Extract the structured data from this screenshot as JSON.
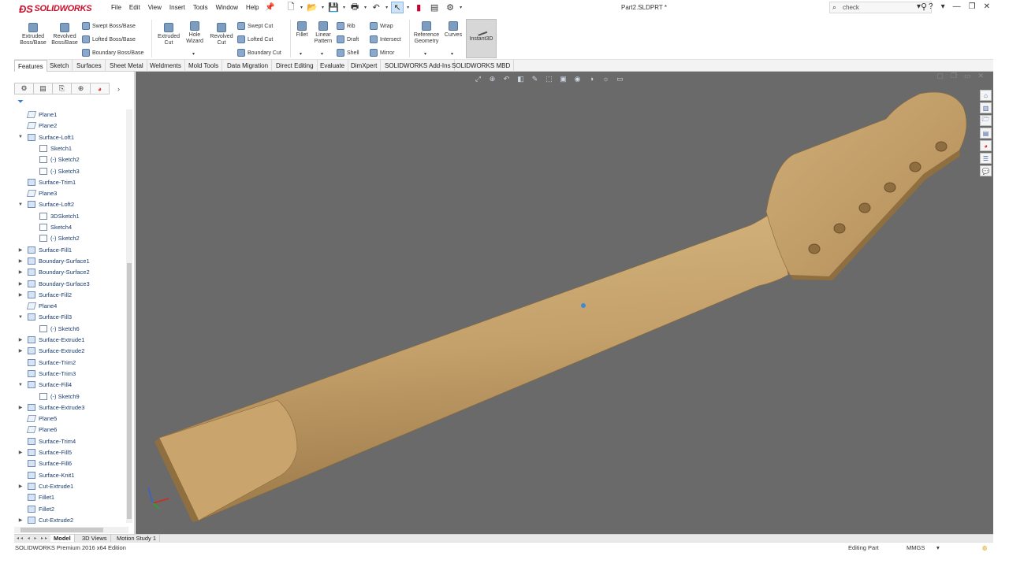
{
  "titlebar": {
    "app": "SOLIDWORKS",
    "menus": [
      "File",
      "Edit",
      "View",
      "Insert",
      "Tools",
      "Window",
      "Help"
    ],
    "document": "Part2.SLDPRT *",
    "search_value": "check",
    "help": "?"
  },
  "ribbon": {
    "extruded_boss": "Extruded Boss/Base",
    "revolved_boss": "Revolved Boss/Base",
    "swept_boss": "Swept Boss/Base",
    "lofted_boss": "Lofted Boss/Base",
    "boundary_boss": "Boundary Boss/Base",
    "extruded_cut": "Extruded Cut",
    "hole_wizard": "Hole Wizard",
    "revolved_cut": "Revolved Cut",
    "swept_cut": "Swept Cut",
    "lofted_cut": "Lofted Cut",
    "boundary_cut": "Boundary Cut",
    "fillet": "Fillet",
    "linear_pattern": "Linear Pattern",
    "rib": "Rib",
    "draft": "Draft",
    "shell": "Shell",
    "wrap": "Wrap",
    "intersect": "Intersect",
    "mirror": "Mirror",
    "reference_geometry": "Reference Geometry",
    "curves": "Curves",
    "instant3d": "Instant3D"
  },
  "tabs": [
    "Features",
    "Sketch",
    "Surfaces",
    "Sheet Metal",
    "Weldments",
    "Mold Tools",
    "Data Migration",
    "Direct Editing",
    "Evaluate",
    "DimXpert",
    "SOLIDWORKS Add-Ins",
    "SOLIDWORKS MBD"
  ],
  "tree": [
    {
      "label": "Plane1",
      "level": 0,
      "icon": "plane-icon",
      "expand": ""
    },
    {
      "label": "Plane2",
      "level": 0,
      "icon": "plane-icon",
      "expand": ""
    },
    {
      "label": "Surface-Loft1",
      "level": 0,
      "icon": "surface-loft-icon",
      "expand": "▼"
    },
    {
      "label": "Sketch1",
      "level": 1,
      "icon": "sketch-icon",
      "expand": ""
    },
    {
      "label": "(-) Sketch2",
      "level": 1,
      "icon": "sketch-icon",
      "expand": ""
    },
    {
      "label": "(-) Sketch3",
      "level": 1,
      "icon": "sketch-icon",
      "expand": ""
    },
    {
      "label": "Surface-Trim1",
      "level": 0,
      "icon": "surface-trim-icon",
      "expand": ""
    },
    {
      "label": "Plane3",
      "level": 0,
      "icon": "plane-icon",
      "expand": ""
    },
    {
      "label": "Surface-Loft2",
      "level": 0,
      "icon": "surface-loft-icon",
      "expand": "▼"
    },
    {
      "label": "3DSketch1",
      "level": 1,
      "icon": "sketch-icon",
      "expand": ""
    },
    {
      "label": "Sketch4",
      "level": 1,
      "icon": "sketch-icon",
      "expand": ""
    },
    {
      "label": "(-) Sketch2",
      "level": 1,
      "icon": "sketch-icon",
      "expand": ""
    },
    {
      "label": "Surface-Fill1",
      "level": 0,
      "icon": "surface-fill-icon",
      "expand": "▶"
    },
    {
      "label": "Boundary-Surface1",
      "level": 0,
      "icon": "boundary-surface-icon",
      "expand": "▶"
    },
    {
      "label": "Boundary-Surface2",
      "level": 0,
      "icon": "boundary-surface-icon",
      "expand": "▶"
    },
    {
      "label": "Boundary-Surface3",
      "level": 0,
      "icon": "boundary-surface-icon",
      "expand": "▶"
    },
    {
      "label": "Surface-Fill2",
      "level": 0,
      "icon": "surface-fill-icon",
      "expand": "▶"
    },
    {
      "label": "Plane4",
      "level": 0,
      "icon": "plane-icon",
      "expand": ""
    },
    {
      "label": "Surface-Fill3",
      "level": 0,
      "icon": "surface-fill-icon",
      "expand": "▼"
    },
    {
      "label": "(-) Sketch6",
      "level": 1,
      "icon": "sketch-icon",
      "expand": ""
    },
    {
      "label": "Surface-Extrude1",
      "level": 0,
      "icon": "surface-extrude-icon",
      "expand": "▶"
    },
    {
      "label": "Surface-Extrude2",
      "level": 0,
      "icon": "surface-extrude-icon",
      "expand": "▶"
    },
    {
      "label": "Surface-Trim2",
      "level": 0,
      "icon": "surface-trim-icon",
      "expand": ""
    },
    {
      "label": "Surface-Trim3",
      "level": 0,
      "icon": "surface-trim-icon",
      "expand": ""
    },
    {
      "label": "Surface-Fill4",
      "level": 0,
      "icon": "surface-fill-icon",
      "expand": "▼"
    },
    {
      "label": "(-) Sketch9",
      "level": 1,
      "icon": "sketch-icon",
      "expand": ""
    },
    {
      "label": "Surface-Extrude3",
      "level": 0,
      "icon": "surface-extrude-icon",
      "expand": "▶"
    },
    {
      "label": "Plane5",
      "level": 0,
      "icon": "plane-icon",
      "expand": ""
    },
    {
      "label": "Plane6",
      "level": 0,
      "icon": "plane-icon",
      "expand": ""
    },
    {
      "label": "Surface-Trim4",
      "level": 0,
      "icon": "surface-trim-icon",
      "expand": ""
    },
    {
      "label": "Surface-Fill5",
      "level": 0,
      "icon": "surface-fill-icon",
      "expand": "▶"
    },
    {
      "label": "Surface-Fill6",
      "level": 0,
      "icon": "surface-fill-icon",
      "expand": ""
    },
    {
      "label": "Surface-Knit1",
      "level": 0,
      "icon": "surface-knit-icon",
      "expand": ""
    },
    {
      "label": "Cut-Extrude1",
      "level": 0,
      "icon": "cut-extrude-icon",
      "expand": "▶"
    },
    {
      "label": "Fillet1",
      "level": 0,
      "icon": "fillet-icon",
      "expand": ""
    },
    {
      "label": "Fillet2",
      "level": 0,
      "icon": "fillet-icon",
      "expand": ""
    },
    {
      "label": "Cut-Extrude2",
      "level": 0,
      "icon": "cut-extrude-icon",
      "expand": "▶"
    }
  ],
  "bottom_tabs": [
    "Model",
    "3D Views",
    "Motion Study 1"
  ],
  "status": {
    "edition": "SOLIDWORKS Premium 2016 x64 Edition",
    "mode": "Editing Part",
    "units": "MMGS"
  },
  "colors": {
    "viewport_bg": "#6a6a6a",
    "wood": "#c4a06a",
    "brand": "#c8102e"
  }
}
